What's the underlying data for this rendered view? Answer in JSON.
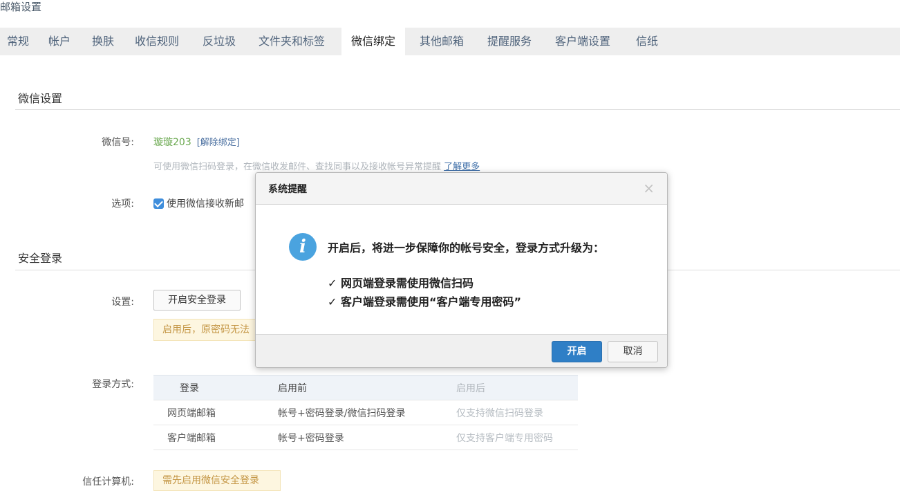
{
  "page": {
    "title": "邮箱设置"
  },
  "tabs": [
    {
      "label": "常规"
    },
    {
      "label": "帐户"
    },
    {
      "label": "换肤"
    },
    {
      "label": "收信规则"
    },
    {
      "label": "反垃圾"
    },
    {
      "label": "文件夹和标签"
    },
    {
      "label": "微信绑定",
      "active": true
    },
    {
      "label": "其他邮箱"
    },
    {
      "label": "提醒服务"
    },
    {
      "label": "客户端设置"
    },
    {
      "label": "信纸"
    }
  ],
  "wechat": {
    "section_title": "微信设置",
    "account_label": "微信号:",
    "account_value": "璇璇203",
    "unbind_label": "[解除绑定]",
    "hint": "可使用微信扫码登录，在微信收发邮件、查找同事以及接收帐号异常提醒",
    "learn_more": "了解更多",
    "options_label": "选项:",
    "option_checkbox_label": "使用微信接收新邮"
  },
  "secure_login": {
    "section_title": "安全登录",
    "settings_label": "设置:",
    "enable_button": "开启安全登录",
    "warning": "启用后，原密码无法",
    "method_label": "登录方式:",
    "table": {
      "headers": [
        "登录",
        "启用前",
        "启用后"
      ],
      "rows": [
        [
          "网页端邮箱",
          "帐号+密码登录/微信扫码登录",
          "仅支持微信扫码登录"
        ],
        [
          "客户端邮箱",
          "帐号+密码登录",
          "仅支持客户端专用密码"
        ]
      ]
    },
    "trust_label": "信任计算机:",
    "trust_value": "需先启用微信安全登录"
  },
  "modal": {
    "title": "系统提醒",
    "close_icon": "×",
    "main_text": "开启后，将进一步保障你的帐号安全，登录方式升级为：",
    "bullets": [
      "✓ 网页端登录需使用微信扫码",
      "✓ 客户端登录需使用“客户端专用密码”"
    ],
    "confirm_label": "开启",
    "cancel_label": "取消"
  },
  "colors": {
    "accent_green": "#6aa84f",
    "primary_blue": "#2f7fc6",
    "info_icon_blue": "#4aa3df",
    "warning_text": "#c49645"
  }
}
